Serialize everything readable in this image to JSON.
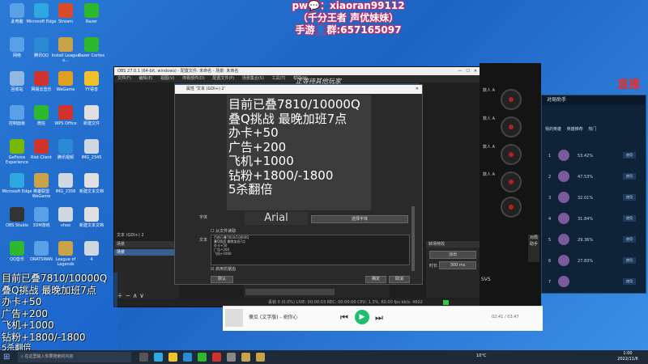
{
  "banner": {
    "line1": "pw💬：xiaoran99112",
    "line2": "（千分王者 声优妹妹）",
    "line3": "手游👤群:657165097"
  },
  "desktop_icons": [
    {
      "label": "此电脑",
      "color": "#5aa0e6"
    },
    {
      "label": "Microsoft Edge",
      "color": "#2fa7e0"
    },
    {
      "label": "Stream",
      "color": "#d94c2b"
    },
    {
      "label": "Razer",
      "color": "#2eb82e"
    },
    {
      "label": "网络",
      "color": "#5aa0e6"
    },
    {
      "label": "腾讯QQ",
      "color": "#2a8ad4"
    },
    {
      "label": "Install League o...",
      "color": "#c9a34a"
    },
    {
      "label": "Razer Cortex",
      "color": "#2eb82e"
    },
    {
      "label": "回收站",
      "color": "#8fb7e0"
    },
    {
      "label": "网易云音乐",
      "color": "#d0332e"
    },
    {
      "label": "WeGame",
      "color": "#e0a020"
    },
    {
      "label": "YY语音",
      "color": "#f2c02a"
    },
    {
      "label": "控制面板",
      "color": "#5aa0e6"
    },
    {
      "label": "微信",
      "color": "#2eb82e"
    },
    {
      "label": "WPS Office",
      "color": "#d0332e"
    },
    {
      "label": "新建文件",
      "color": "#e0e0e0"
    },
    {
      "label": "GeForce Experience",
      "color": "#76b900"
    },
    {
      "label": "Riot Client",
      "color": "#d0332e"
    },
    {
      "label": "腾讯视频",
      "color": "#2a8ad4"
    },
    {
      "label": "IMG_2345",
      "color": "#cfd8e0"
    },
    {
      "label": "Microsoft Edge",
      "color": "#2fa7e0"
    },
    {
      "label": "英雄联盟WeGame",
      "color": "#c9a34a"
    },
    {
      "label": "IMG_2356",
      "color": "#cfd8e0"
    },
    {
      "label": "新建文本文档",
      "color": "#e0e0e0"
    },
    {
      "label": "OBS Studio",
      "color": "#333333"
    },
    {
      "label": "3DM游戏",
      "color": "#5aa0e6"
    },
    {
      "label": "vhoo",
      "color": "#cfd8e0"
    },
    {
      "label": "新建文本文档",
      "color": "#e0e0e0"
    },
    {
      "label": "QQ音乐",
      "color": "#2eb82e"
    },
    {
      "label": "DRATSMAN",
      "color": "#5aa0e6"
    },
    {
      "label": "League of Legends",
      "color": "#c9a34a"
    },
    {
      "label": "4",
      "color": "#cfd8e0"
    }
  ],
  "obs": {
    "title": "OBS 27.0.1 (64-bit, windows) - 配置文件: 未命名 - 场景: 未命名",
    "menu": [
      "文件(F)",
      "编辑(E)",
      "视图(V)",
      "停靠部件(D)",
      "配置文件(P)",
      "场景集合(S)",
      "工具(T)",
      "帮助(H)"
    ],
    "preview_caption": "正等待其他玩家",
    "dock_scenes": "场景",
    "dock_scene_item": "场景",
    "dock_sources": "文本 (GDI+) 2",
    "dock_transitions": "转场特效",
    "transition_value": "淡出",
    "duration_label": "时长",
    "duration_value": "300 ms",
    "status": "丢帧 0 (0.0%)   LIVE: 00:00:03   REC: 00:00:00   CPU: 1.3%, 60.00 fps   kb/s: 4602"
  },
  "props": {
    "title": "属性 '文本 (GDI+) 2'",
    "lines": [
      "目前已叠7810/10000Q",
      "叠Q挑战 最晚加班7点",
      "办卡+50",
      "广告+200",
      "飞机+1000",
      "钻粉+1800/-1800",
      "5杀翻倍"
    ],
    "font_label": "字体",
    "font_value": "Arial",
    "select_font": "选择字体",
    "from_file": "从文件读取",
    "text_label": "文本",
    "textarea_lines": [
      "目前已叠7810/10000Q",
      "叠Q挑战 最晚加班7点",
      "办卡+50",
      "广告+200",
      "飞机+1000"
    ],
    "antialias": "启用抗锯齿",
    "defaults": "默认",
    "ok": "确定",
    "cancel": "取消"
  },
  "right_pane": {
    "items": [
      "数人 A",
      "数人 A",
      "数人 A",
      "数人 A"
    ],
    "cam_label": "对局助手",
    "sys": "SVS"
  },
  "live_label": "直播",
  "helper": {
    "title": "对局助手",
    "tabs": [
      "我的英雄",
      "英雄推荐",
      "热门"
    ],
    "rows": [
      {
        "num": "1",
        "rate": "53.42%",
        "btn": "使用"
      },
      {
        "num": "2",
        "rate": "47.53%",
        "btn": "使用"
      },
      {
        "num": "3",
        "rate": "32.01%",
        "btn": "使用"
      },
      {
        "num": "4",
        "rate": "31.84%",
        "btn": "使用"
      },
      {
        "num": "5",
        "rate": "29.36%",
        "btn": "使用"
      },
      {
        "num": "6",
        "rate": "27.83%",
        "btn": "使用"
      },
      {
        "num": "7",
        "rate": "",
        "btn": "使用"
      }
    ]
  },
  "overlay_left": [
    "目前已叠7810/10000Q",
    "叠Q挑战 最晚加班7点",
    "办卡+50",
    "广告+200",
    "飞机+1000",
    "钻粉+1800/-1800",
    "5杀翻倍"
  ],
  "player": {
    "song": "傻瓜 (文学版) - 祝你心",
    "time": "02:41 / 03:47"
  },
  "taskbar": {
    "search_placeholder": "在这里输入你要搜索的内容",
    "weather": "10°C",
    "date": "2022/11/6",
    "time": "1:00"
  },
  "colors": {
    "accent": "#1a5fb4",
    "live": "#e0322f",
    "obs_bg": "#1e1e1e"
  }
}
